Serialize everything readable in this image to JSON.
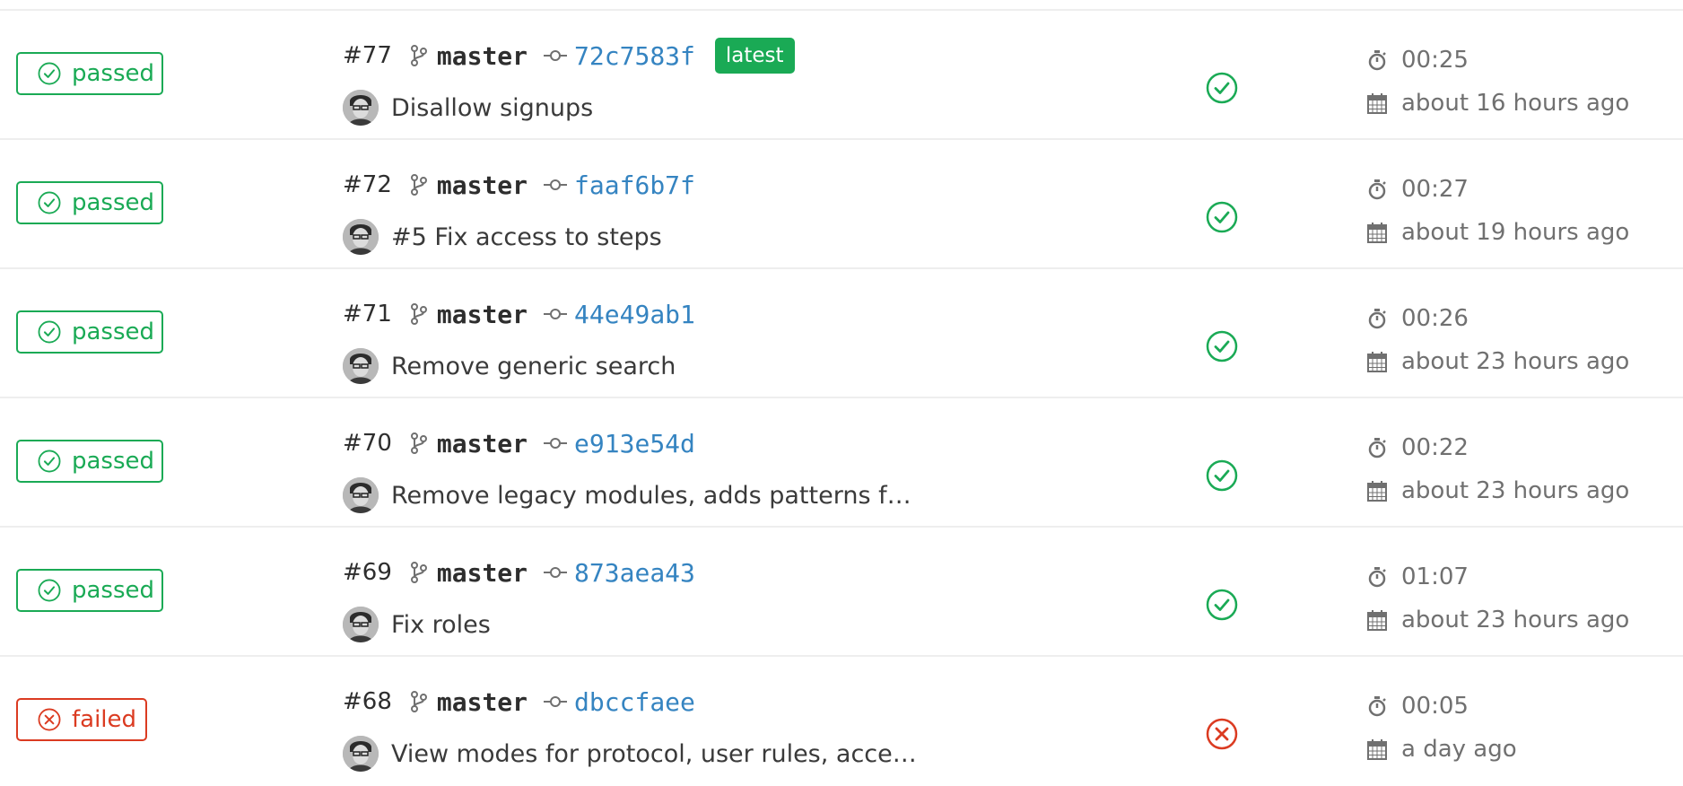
{
  "colors": {
    "success": "#1aaa55",
    "failed": "#db3b21",
    "link": "#3584c1",
    "muted": "#707070"
  },
  "icons": {
    "status_passed": "check-circle-icon",
    "status_failed": "x-circle-icon",
    "branch": "git-branch-icon",
    "commit": "git-commit-icon",
    "duration": "stopwatch-icon",
    "finished": "calendar-icon"
  },
  "pipelines": [
    {
      "status": "passed",
      "status_label": "passed",
      "id": "#77",
      "branch": "master",
      "sha": "72c7583f",
      "latest": true,
      "latest_label": "latest",
      "title": "Disallow signups",
      "stage_status": "passed",
      "duration": "00:25",
      "finished": "about 16 hours ago"
    },
    {
      "status": "passed",
      "status_label": "passed",
      "id": "#72",
      "branch": "master",
      "sha": "faaf6b7f",
      "latest": false,
      "title": "#5 Fix access to steps",
      "stage_status": "passed",
      "duration": "00:27",
      "finished": "about 19 hours ago"
    },
    {
      "status": "passed",
      "status_label": "passed",
      "id": "#71",
      "branch": "master",
      "sha": "44e49ab1",
      "latest": false,
      "title": "Remove generic search",
      "stage_status": "passed",
      "duration": "00:26",
      "finished": "about 23 hours ago"
    },
    {
      "status": "passed",
      "status_label": "passed",
      "id": "#70",
      "branch": "master",
      "sha": "e913e54d",
      "latest": false,
      "title": "Remove legacy modules, adds patterns f…",
      "stage_status": "passed",
      "duration": "00:22",
      "finished": "about 23 hours ago"
    },
    {
      "status": "passed",
      "status_label": "passed",
      "id": "#69",
      "branch": "master",
      "sha": "873aea43",
      "latest": false,
      "title": "Fix roles",
      "stage_status": "passed",
      "duration": "01:07",
      "finished": "about 23 hours ago"
    },
    {
      "status": "failed",
      "status_label": "failed",
      "id": "#68",
      "branch": "master",
      "sha": "dbccfaee",
      "latest": false,
      "title": "View modes for protocol, user rules, acce…",
      "stage_status": "failed",
      "duration": "00:05",
      "finished": "a day ago"
    }
  ]
}
